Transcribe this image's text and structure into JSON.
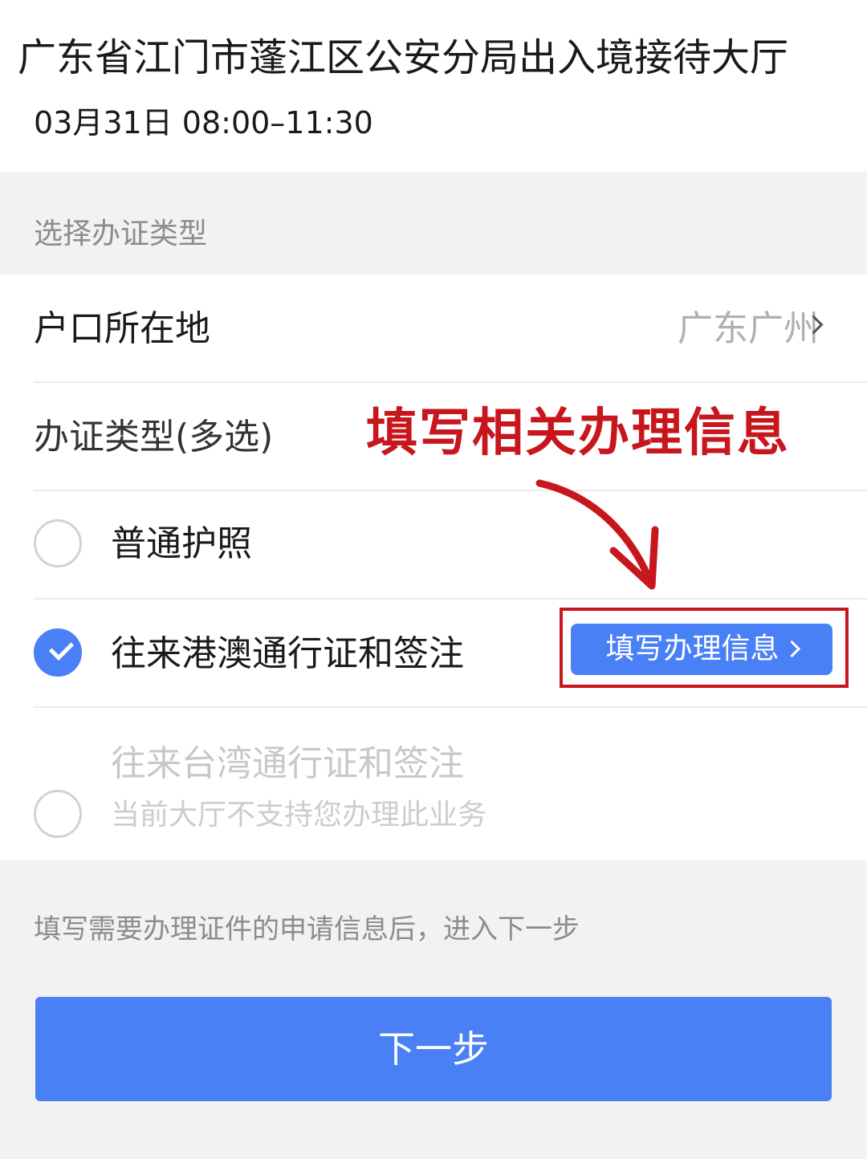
{
  "header": {
    "hall_name": "广东省江门市蓬江区公安分局出入境接待大厅",
    "time_slot": "03月31日 08:00–11:30"
  },
  "section": {
    "label": "选择办证类型"
  },
  "form": {
    "location_label": "户口所在地",
    "location_value": "广东广州",
    "type_label": "办证类型(多选)",
    "options": [
      {
        "label": "普通护照",
        "checked": false,
        "disabled": false
      },
      {
        "label": "往来港澳通行证和签注",
        "checked": true,
        "disabled": false,
        "action_label": "填写办理信息"
      },
      {
        "label": "往来台湾通行证和签注",
        "checked": false,
        "disabled": true,
        "note": "当前大厅不支持您办理此业务"
      }
    ]
  },
  "annotation": {
    "text": "填写相关办理信息",
    "color": "#c8161d"
  },
  "footer": {
    "hint": "填写需要办理证件的申请信息后，进入下一步",
    "next_label": "下一步"
  },
  "colors": {
    "accent": "#4a80f5",
    "annotation": "#c8161d"
  }
}
